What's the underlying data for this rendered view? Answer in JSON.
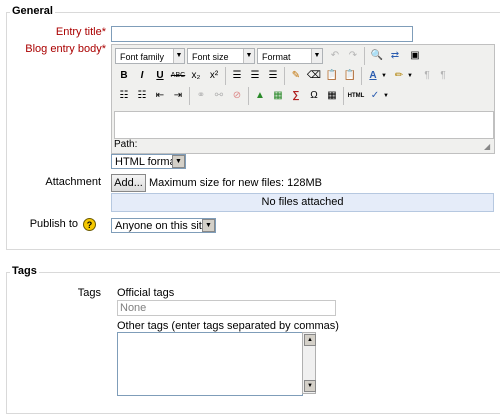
{
  "general": {
    "legend": "General",
    "entry_title_label": "Entry title",
    "entry_title_value": "",
    "blog_body_label": "Blog entry body",
    "required_marker": "*",
    "editor": {
      "font_family": "Font family",
      "font_size": "Font size",
      "format": "Format",
      "path_label": "Path:",
      "toolbar_row2": [
        "B",
        "I",
        "U",
        "ABC",
        "x₂",
        "x²"
      ],
      "html_btn": "HTML",
      "omega": "Ω"
    },
    "text_format": "HTML format",
    "attachment_label": "Attachment",
    "add_button": "Add...",
    "max_size": "Maximum size for new files: 128MB",
    "no_files": "No files attached",
    "publish_label": "Publish to",
    "publish_value": "Anyone on this site"
  },
  "tags": {
    "legend": "Tags",
    "label": "Tags",
    "official_label": "Official tags",
    "official_value": "None",
    "other_label": "Other tags (enter tags separated by commas)"
  }
}
